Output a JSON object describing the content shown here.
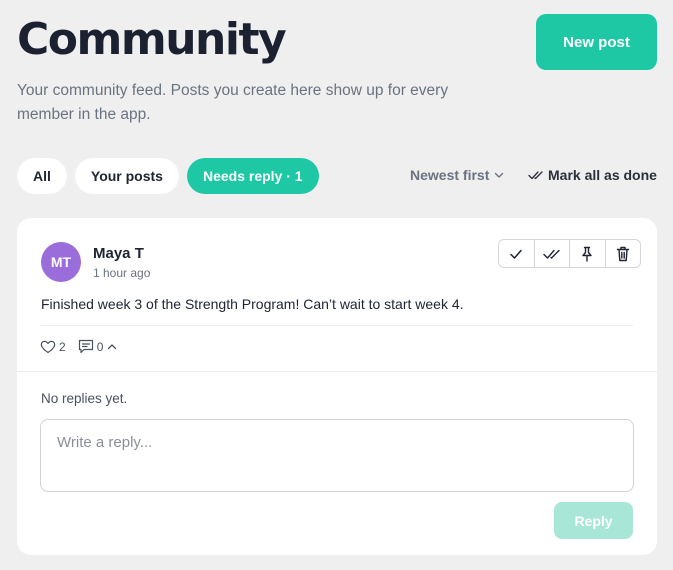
{
  "header": {
    "title": "Community",
    "new_post_label": "New post",
    "subtitle": "Your community feed. Posts you create here show up for every member in the app."
  },
  "filters": [
    {
      "label": "All",
      "active": false
    },
    {
      "label": "Your posts",
      "active": false
    },
    {
      "label": "Needs reply · 1",
      "active": true
    }
  ],
  "sort": {
    "label": "Newest first",
    "icon": "chevron-down-icon"
  },
  "mark_all": {
    "label": "Mark all as done",
    "icon": "double-check-icon"
  },
  "post": {
    "avatar_initials": "MT",
    "avatar_color": "#9a6ddb",
    "author": "Maya T",
    "time": "1 hour ago",
    "body": "Finished week 3 of the Strength Program! Can’t wait to start week 4.",
    "likes": "2",
    "comments": "0",
    "actions": [
      "check-icon",
      "double-check-icon",
      "pin-icon",
      "trash-icon"
    ]
  },
  "replies": {
    "empty_text": "No replies yet.",
    "placeholder": "Write a reply...",
    "reply_label": "Reply"
  },
  "colors": {
    "accent": "#1ec8a5",
    "accent_disabled": "#a8e6d8",
    "background": "#efefef"
  }
}
